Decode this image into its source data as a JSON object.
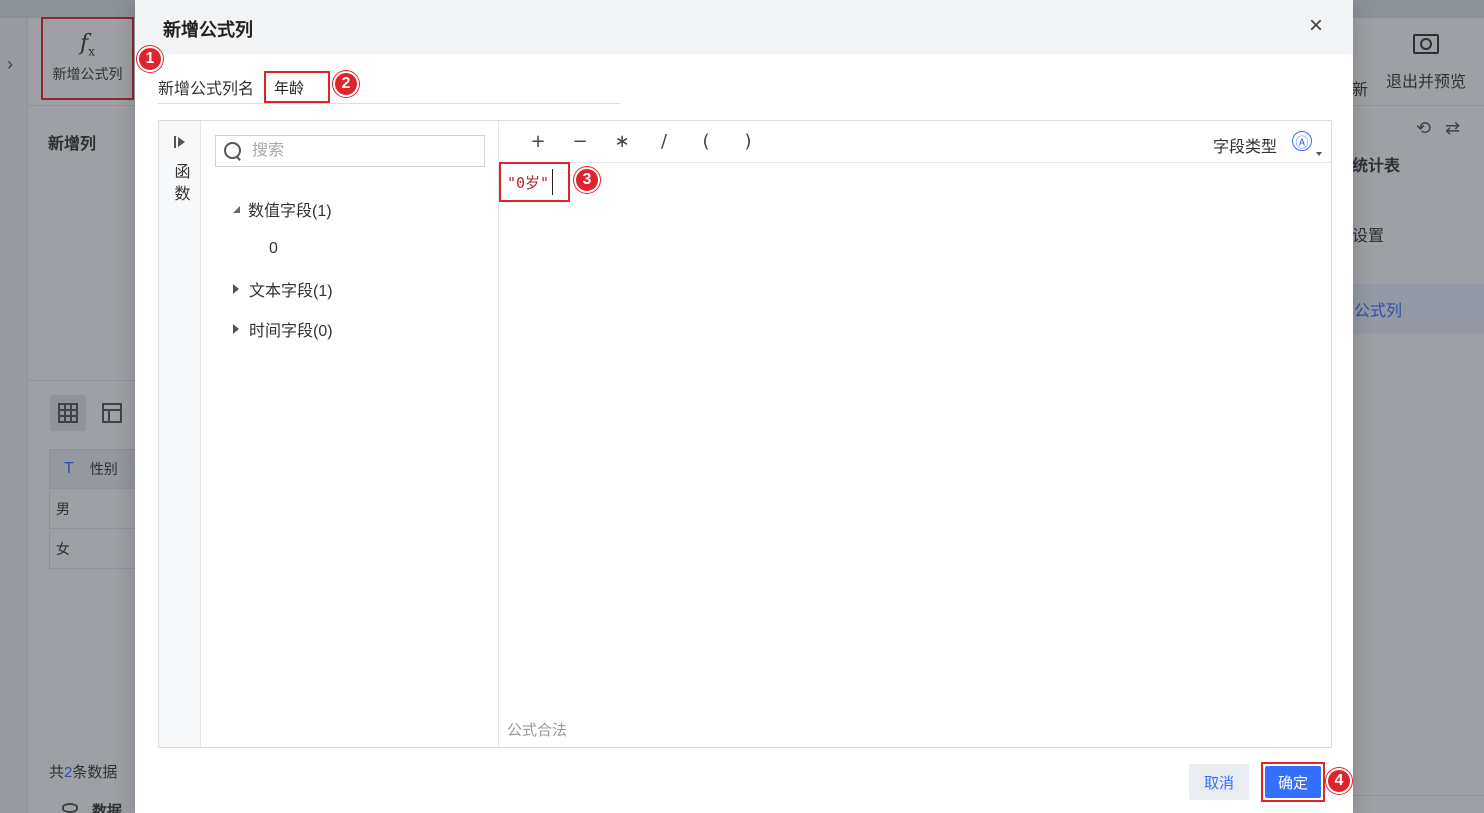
{
  "background": {
    "toolbar": {
      "add_formula_column": "新增公式列",
      "exit_preview": "退出并预览",
      "partial_new": "新"
    },
    "left_section_title": "新增列",
    "table": {
      "header": "性别",
      "rows": [
        "男",
        "女"
      ]
    },
    "record_count": {
      "prefix": "共",
      "number": "2",
      "suffix": "条数据"
    },
    "bottom_label": "数据",
    "right_panel": {
      "title_partial": "统计表",
      "setting_partial": "设置",
      "formula_partial": "公式列"
    }
  },
  "dialog": {
    "title": "新增公式列",
    "close_label": "×",
    "column_name_label": "新增公式列名",
    "column_name_value": "年龄",
    "function_sidebar_label": "函数",
    "search_placeholder": "搜索",
    "field_groups": [
      {
        "label": "数值字段(1)",
        "expanded": true,
        "items": [
          "0"
        ]
      },
      {
        "label": "文本字段(1)",
        "expanded": false,
        "items": []
      },
      {
        "label": "时间字段(0)",
        "expanded": false,
        "items": []
      }
    ],
    "operators": [
      "+",
      "−",
      "∗",
      "/",
      "(",
      ")"
    ],
    "field_type_label": "字段类型",
    "field_type_icon": "Ⓐ",
    "formula_text": "\"0岁\"",
    "formula_status": "公式合法",
    "cancel_label": "取消",
    "ok_label": "确定"
  },
  "annotations": [
    "1",
    "2",
    "3",
    "4"
  ],
  "colors": {
    "accent": "#3370ff",
    "annotation": "#e0242b"
  }
}
